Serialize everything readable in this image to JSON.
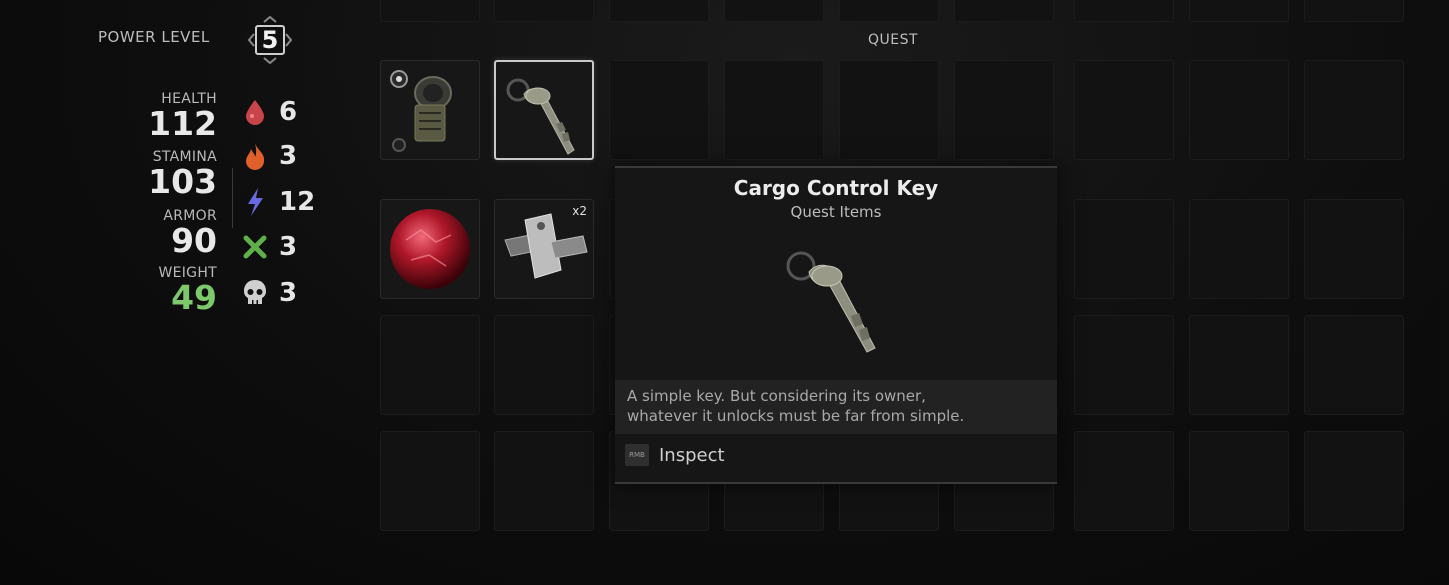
{
  "power": {
    "label": "POWER LEVEL",
    "value": "5"
  },
  "stats": [
    {
      "label": "HEALTH",
      "value": "112"
    },
    {
      "label": "STAMINA",
      "value": "103"
    },
    {
      "label": "ARMOR",
      "value": "90"
    },
    {
      "label": "WEIGHT",
      "value": "49"
    }
  ],
  "resistances": [
    {
      "icon": "blood-drop-icon",
      "value": "6",
      "color": "#c8434a"
    },
    {
      "icon": "fire-icon",
      "value": "3",
      "color": "#e0602c"
    },
    {
      "icon": "lightning-icon",
      "value": "12",
      "color": "#6a6ae0"
    },
    {
      "icon": "crossed-bones-icon",
      "value": "3",
      "color": "#5fb04a"
    },
    {
      "icon": "skull-icon",
      "value": "3",
      "color": "#cfcfcf"
    }
  ],
  "inventory": {
    "section_label": "QUEST",
    "items": [
      {
        "name": "radio-device",
        "icon": "radio-device-icon"
      },
      {
        "name": "cargo-control-key",
        "icon": "key-icon",
        "selected": true
      },
      {
        "name": "red-orb",
        "icon": "red-orb-icon"
      },
      {
        "name": "metal-plates",
        "icon": "metal-plates-icon",
        "count": "x2"
      }
    ]
  },
  "tooltip": {
    "title": "Cargo Control Key",
    "subtitle": "Quest Items",
    "description_line1": "A simple key. But considering its owner,",
    "description_line2": "whatever it unlocks must be far from simple.",
    "action_key": "RMB",
    "action_label": "Inspect"
  }
}
